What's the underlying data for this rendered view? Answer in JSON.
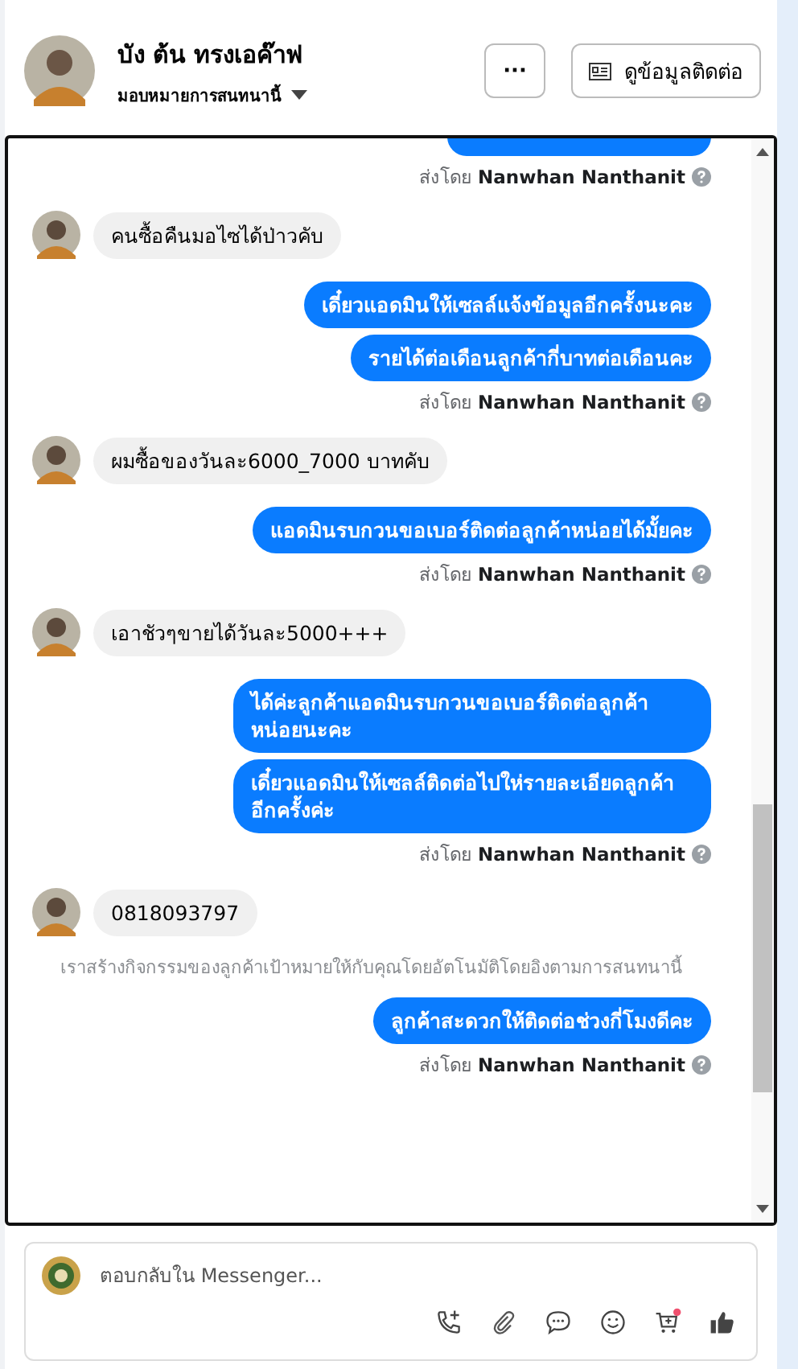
{
  "header": {
    "name": "บัง ต้น ทรงเอค๊าฟ",
    "assign": "มอบหมายการสนทนานี้",
    "more_button": "···",
    "contact_button": "ดูข้อมูลติดต่อ"
  },
  "messages": [
    {
      "kind": "partial"
    },
    {
      "kind": "sent_by",
      "prefix": "ส่งโดย",
      "name": "Nanwhan Nanthanit"
    },
    {
      "kind": "incoming",
      "text": "คนซื้อคืนมอไซได้ป่าวคับ"
    },
    {
      "kind": "outgoing",
      "text": "เดี๋ยวแอดมินให้เซลล์แจ้งข้อมูลอีกครั้งนะคะ"
    },
    {
      "kind": "outgoing",
      "text": "รายได้ต่อเดือนลูกค้ากี่บาทต่อเดือนคะ"
    },
    {
      "kind": "sent_by",
      "prefix": "ส่งโดย",
      "name": "Nanwhan Nanthanit"
    },
    {
      "kind": "incoming",
      "text": "ผมซื้อของวันละ6000_7000 บาทคับ"
    },
    {
      "kind": "outgoing",
      "text": "แอดมินรบกวนขอเบอร์ติดต่อลูกค้าหน่อยได้มั้ยคะ"
    },
    {
      "kind": "sent_by",
      "prefix": "ส่งโดย",
      "name": "Nanwhan Nanthanit"
    },
    {
      "kind": "incoming",
      "text": "เอาชัวๆขายได้วันละ5000+++"
    },
    {
      "kind": "outgoing",
      "text": "ได้ค่ะลูกค้าแอดมินรบกวนขอเบอร์ติดต่อลูกค้าหน่อยนะคะ"
    },
    {
      "kind": "outgoing",
      "text": "เดี๋ยวแอดมินให้เซลล์ติดต่อไปให่รายละเอียดลูกค้าอีกครั้งค่ะ"
    },
    {
      "kind": "sent_by",
      "prefix": "ส่งโดย",
      "name": "Nanwhan Nanthanit"
    },
    {
      "kind": "incoming",
      "text": "0818093797"
    },
    {
      "kind": "system",
      "text": "เราสร้างกิจกรรมของลูกค้าเป้าหมายให้กับคุณโดยอัตโนมัติโดยอิงตามการสนทนานี้"
    },
    {
      "kind": "outgoing",
      "text": "ลูกค้าสะดวกให้ติดต่อช่วงกี่โมงดีคะ"
    },
    {
      "kind": "sent_by",
      "prefix": "ส่งโดย",
      "name": "Nanwhan Nanthanit"
    }
  ],
  "composer": {
    "placeholder": "ตอบกลับใน Messenger..."
  }
}
